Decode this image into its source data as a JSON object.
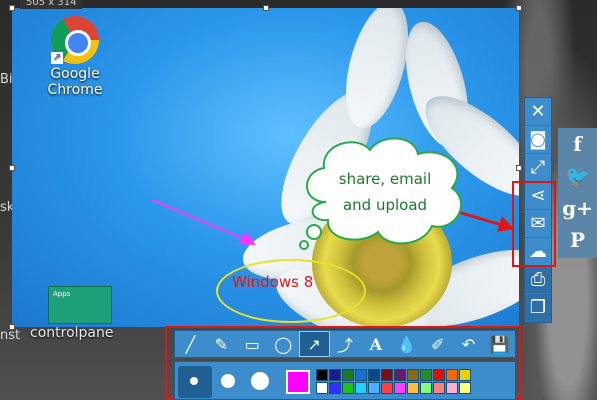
{
  "selection": {
    "size_label": "505 x 314"
  },
  "desktop": {
    "left_labels": [
      "Bin",
      "sk...",
      "nst"
    ],
    "icons": [
      {
        "label_line1": "Google",
        "label_line2": "Chrome"
      },
      {
        "label": "controlpane"
      }
    ],
    "apps_tile": {
      "label": "Apps"
    }
  },
  "annotations": {
    "ellipse_text": "Windows 8",
    "cloud_line1": "share, email",
    "cloud_line2": "and upload"
  },
  "side_toolbar": {
    "buttons": [
      "close-icon",
      "camera-icon",
      "fullscreen-icon",
      "share-icon",
      "email-icon",
      "upload-icon",
      "print-icon",
      "copy-icon"
    ]
  },
  "social": {
    "buttons": [
      "f",
      "twitter",
      "g+",
      "P"
    ]
  },
  "bottom_toolbar": {
    "tools": [
      "line",
      "brush",
      "rectangle",
      "ellipse",
      "arrow",
      "curved-arrow",
      "text",
      "blur",
      "highlighter",
      "undo",
      "save"
    ],
    "active_tool": "arrow",
    "current_color": "#ff00ff",
    "palette": [
      "#000000",
      "#1c1c8c",
      "#1f7a1f",
      "#1e6fd0",
      "#0b4a8a",
      "#7a1010",
      "#6a1a6a",
      "#8a6a10",
      "#2a8a2a",
      "#e01010",
      "#ff6a00",
      "#e8d010",
      "#ffffff",
      "#3030ff",
      "#20c020",
      "#20d0ff",
      "#50b0ff",
      "#ff4040",
      "#ff40ff",
      "#ffc040",
      "#80ff80",
      "#ff8080",
      "#ffb0d0",
      "#ffff80"
    ]
  },
  "colors": {
    "toolbar": "#3d8dcc",
    "accent_red": "#e01616",
    "ellipse": "#e8e22a"
  }
}
